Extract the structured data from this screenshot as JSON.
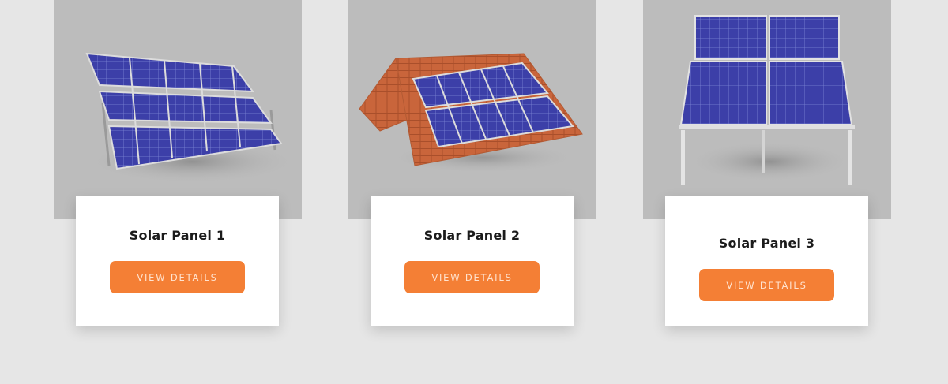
{
  "products": [
    {
      "title": "Solar Panel 1",
      "button_label": "VIEW DETAILS",
      "image_icon": "ground-mounted-solar-panels"
    },
    {
      "title": "Solar Panel 2",
      "button_label": "VIEW DETAILS",
      "image_icon": "roof-mounted-solar-panels"
    },
    {
      "title": "Solar Panel 3",
      "button_label": "VIEW DETAILS",
      "image_icon": "elevated-frame-solar-panels"
    }
  ],
  "colors": {
    "page_background": "#e6e6e6",
    "photo_background": "#bcbcbc",
    "card_background": "#ffffff",
    "button_background": "#f47f35",
    "button_text": "#ffe3cf",
    "title_text": "#1b1b1b",
    "panel_blue": "#3c3fa8",
    "roof_tile": "#c9653b"
  }
}
